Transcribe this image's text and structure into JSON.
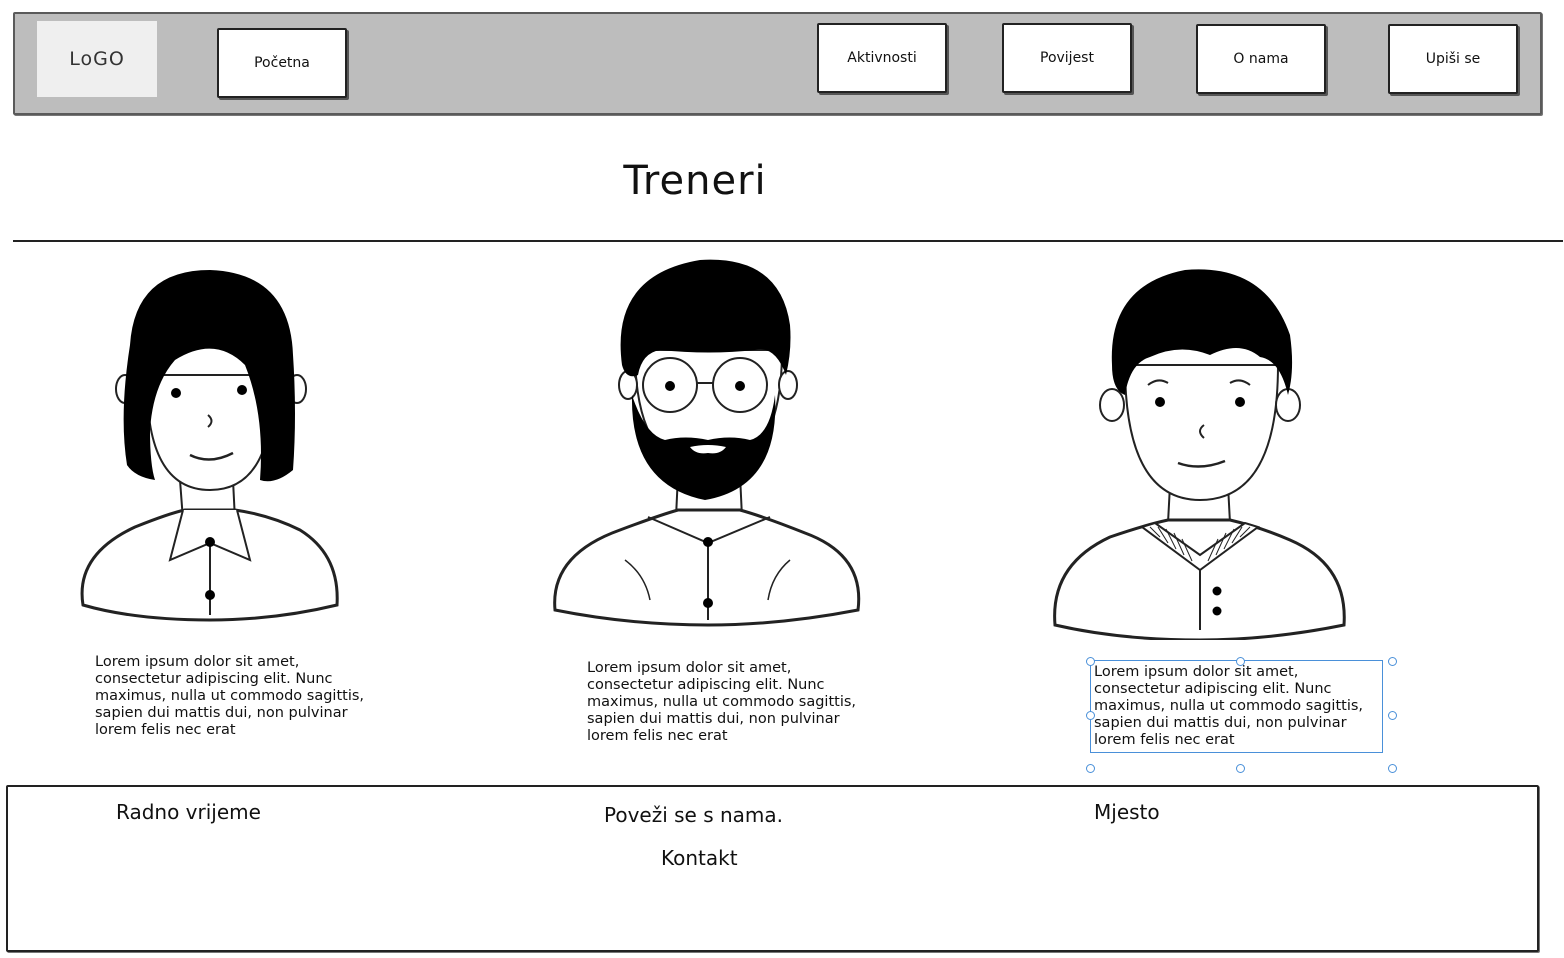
{
  "navbar": {
    "logo_text": "LoGO",
    "items": [
      {
        "label": "Početna"
      },
      {
        "label": "Aktivnosti"
      },
      {
        "label": "Povijest"
      },
      {
        "label": "O nama"
      },
      {
        "label": "Upiši se"
      }
    ]
  },
  "main": {
    "title": "Treneri",
    "trainers": [
      {
        "portrait": "woman-avatar-icon",
        "bio": "Lorem ipsum dolor sit amet, consectetur adipiscing elit. Nunc maximus, nulla ut commodo sagittis, sapien dui mattis dui, non pulvinar lorem felis nec erat"
      },
      {
        "portrait": "bearded-man-avatar-icon",
        "bio": "Lorem ipsum dolor sit amet, consectetur adipiscing elit. Nunc maximus, nulla ut commodo sagittis, sapien dui mattis dui, non pulvinar lorem felis nec erat"
      },
      {
        "portrait": "young-man-avatar-icon",
        "bio": "Lorem ipsum dolor sit amet, consectetur adipiscing elit. Nunc maximus, nulla ut commodo sagittis, sapien dui mattis dui, non pulvinar lorem felis nec erat"
      }
    ]
  },
  "footer": {
    "working_hours": "Radno vrijeme",
    "connect": "Poveži se s nama.",
    "contact": "Kontakt",
    "location": "Mjesto"
  },
  "colors": {
    "navbar_bg": "#bdbdbd",
    "logo_bg": "#efefef",
    "selection": "#4a90d9"
  }
}
